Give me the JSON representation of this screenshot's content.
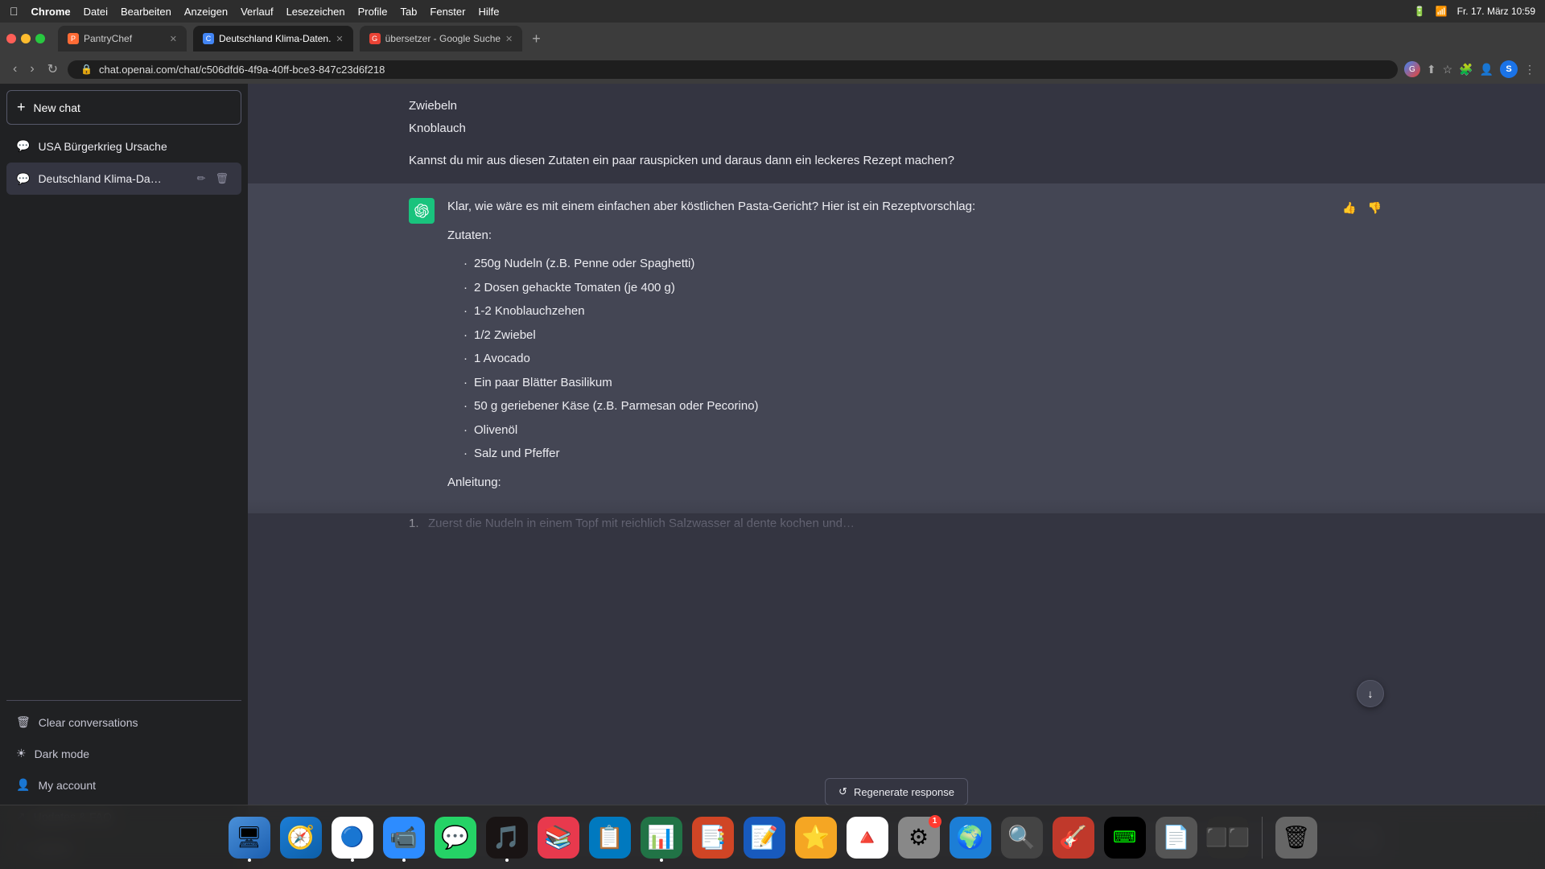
{
  "macos": {
    "menu_items": [
      "Datei",
      "Bearbeiten",
      "Anzeigen",
      "Verlauf",
      "Lesezeichen",
      "Profile",
      "Tab",
      "Fenster",
      "Hilfe"
    ],
    "app_name": "Chrome",
    "datetime": "Fr. 17. März  10:59"
  },
  "browser": {
    "tabs": [
      {
        "id": "tab1",
        "title": "PantryChef",
        "active": false,
        "favicon_color": "#ff6b35"
      },
      {
        "id": "tab2",
        "title": "Deutschland Klima-Daten.",
        "active": true,
        "favicon_color": "#4285f4"
      },
      {
        "id": "tab3",
        "title": "übersetzer - Google Suche",
        "active": false,
        "favicon_color": "#ea4335"
      }
    ],
    "url": "chat.openai.com/chat/c506dfd6-4f9a-40ff-bce3-847c23d6f218"
  },
  "sidebar": {
    "new_chat_label": "New chat",
    "chats": [
      {
        "id": "chat1",
        "title": "USA Bürgerkrieg Ursache",
        "active": false
      },
      {
        "id": "chat2",
        "title": "Deutschland Klima-Da…",
        "active": true
      }
    ],
    "actions": [
      {
        "id": "clear",
        "label": "Clear conversations",
        "icon": "🗑"
      },
      {
        "id": "dark",
        "label": "Dark mode",
        "icon": "☀"
      },
      {
        "id": "account",
        "label": "My account",
        "icon": "👤"
      },
      {
        "id": "updates",
        "label": "Updates & FAQ",
        "icon": "↗"
      },
      {
        "id": "logout",
        "label": "Log out",
        "icon": "⎋"
      }
    ]
  },
  "chat": {
    "user_message_partial": {
      "line1": "Zwiebeln",
      "line2": "Knoblauch",
      "line3": "Kannst du mir aus diesen Zutaten ein paar rauspicken und daraus dann ein leckeres Rezept machen?"
    },
    "ai_message": {
      "intro": "Klar, wie wäre es mit einem einfachen aber köstlichen Pasta-Gericht? Hier ist ein Rezeptvorschlag:",
      "zutaten_label": "Zutaten:",
      "ingredients": [
        "250g Nudeln (z.B. Penne oder Spaghetti)",
        "2 Dosen gehackte Tomaten (je 400 g)",
        "1-2 Knoblauchzehen",
        "1/2 Zwiebel",
        "1 Avocado",
        "Ein paar Blätter Basilikum",
        "50 g geriebener Käse (z.B. Parmesan oder Pecorino)",
        "Olivenöl",
        "Salz und Pfeffer"
      ],
      "anleitung_label": "Anleitung:",
      "steps_partial": [
        "Zuerst die Nudeln in einem Topf mit reichlich Salzwasser al dente kochen und…"
      ]
    },
    "regenerate_label": "Regenerate response",
    "input_placeholder": ""
  },
  "dock": [
    {
      "id": "finder",
      "emoji": "🔵",
      "bg": "#4a90d9",
      "label": "Finder",
      "active": true
    },
    {
      "id": "safari",
      "emoji": "🧭",
      "bg": "#1c7ed6",
      "label": "Safari",
      "active": false
    },
    {
      "id": "chrome",
      "emoji": "🟢",
      "bg": "#2c2c2c",
      "label": "Chrome",
      "active": true
    },
    {
      "id": "zoom",
      "emoji": "📹",
      "bg": "#2d8cff",
      "label": "Zoom",
      "active": false
    },
    {
      "id": "whatsapp",
      "emoji": "💬",
      "bg": "#25d366",
      "label": "WhatsApp",
      "active": false
    },
    {
      "id": "spotify",
      "emoji": "🎵",
      "bg": "#1db954",
      "label": "Spotify",
      "active": false
    },
    {
      "id": "stack",
      "emoji": "📚",
      "bg": "#e8394d",
      "label": "Stacks",
      "active": false
    },
    {
      "id": "trello",
      "emoji": "📋",
      "bg": "#0079bf",
      "label": "Trello",
      "active": false
    },
    {
      "id": "excel",
      "emoji": "📊",
      "bg": "#217346",
      "label": "Excel",
      "active": false
    },
    {
      "id": "ppt",
      "emoji": "📑",
      "bg": "#d04525",
      "label": "PowerPoint",
      "active": false
    },
    {
      "id": "word",
      "emoji": "📝",
      "bg": "#185abd",
      "label": "Word",
      "active": false
    },
    {
      "id": "star",
      "emoji": "⭐",
      "bg": "#f5a623",
      "label": "NotePlan",
      "active": false
    },
    {
      "id": "drive",
      "emoji": "🔺",
      "bg": "#1a73e8",
      "label": "Google Drive",
      "active": false
    },
    {
      "id": "settings",
      "emoji": "⚙",
      "bg": "#888",
      "label": "System Settings",
      "active": false,
      "badge": "1"
    },
    {
      "id": "earth",
      "emoji": "🌍",
      "bg": "#1c7ed6",
      "label": "Maps",
      "active": false
    },
    {
      "id": "search",
      "emoji": "🔍",
      "bg": "#333",
      "label": "Finder Search",
      "active": false
    },
    {
      "id": "music",
      "emoji": "🎸",
      "bg": "#c0392b",
      "label": "GarageBand",
      "active": false
    },
    {
      "id": "terminal",
      "emoji": "⌨",
      "bg": "#222",
      "label": "Terminal",
      "active": false
    },
    {
      "id": "pages",
      "emoji": "📄",
      "bg": "#555",
      "label": "Pages Viewer",
      "active": false
    },
    {
      "id": "spaces",
      "emoji": "⬛",
      "bg": "#2c2c2c",
      "label": "Mission Control",
      "active": false
    },
    {
      "id": "trash",
      "emoji": "🗑",
      "bg": "#666",
      "label": "Trash",
      "active": false
    }
  ]
}
